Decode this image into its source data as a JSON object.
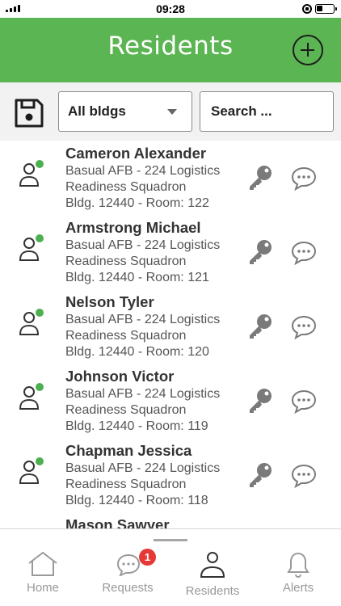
{
  "status_bar": {
    "time": "09:28"
  },
  "header": {
    "title": "Residents"
  },
  "toolbar": {
    "building_select": "All bldgs",
    "search_placeholder": "Search ..."
  },
  "residents": [
    {
      "name": "Cameron Alexander",
      "line1": "Basual AFB - 224 Logistics",
      "line2": "Readiness Squadron",
      "line3": "Bldg. 12440 - Room: 122"
    },
    {
      "name": "Armstrong Michael",
      "line1": "Basual AFB - 224 Logistics",
      "line2": "Readiness Squadron",
      "line3": "Bldg. 12440 - Room: 121"
    },
    {
      "name": "Nelson Tyler",
      "line1": "Basual AFB - 224 Logistics",
      "line2": "Readiness Squadron",
      "line3": "Bldg. 12440 - Room: 120"
    },
    {
      "name": "Johnson Victor",
      "line1": "Basual AFB - 224 Logistics",
      "line2": "Readiness Squadron",
      "line3": "Bldg. 12440 - Room: 119"
    },
    {
      "name": "Chapman Jessica",
      "line1": "Basual AFB - 224 Logistics",
      "line2": "Readiness Squadron",
      "line3": "Bldg. 12440 - Room: 118"
    },
    {
      "name": "Mason Sawyer",
      "line1": "",
      "line2": "",
      "line3": ""
    }
  ],
  "tabs": [
    {
      "label": "Home",
      "icon": "home-icon"
    },
    {
      "label": "Requests",
      "icon": "chat-icon",
      "badge": "1"
    },
    {
      "label": "Residents",
      "icon": "person-icon",
      "active": true
    },
    {
      "label": "Alerts",
      "icon": "bell-icon"
    }
  ],
  "colors": {
    "header_green": "#5bb552",
    "online_dot": "#4caf50",
    "badge_red": "#e53935",
    "icon_gray": "#7a7a7a"
  }
}
